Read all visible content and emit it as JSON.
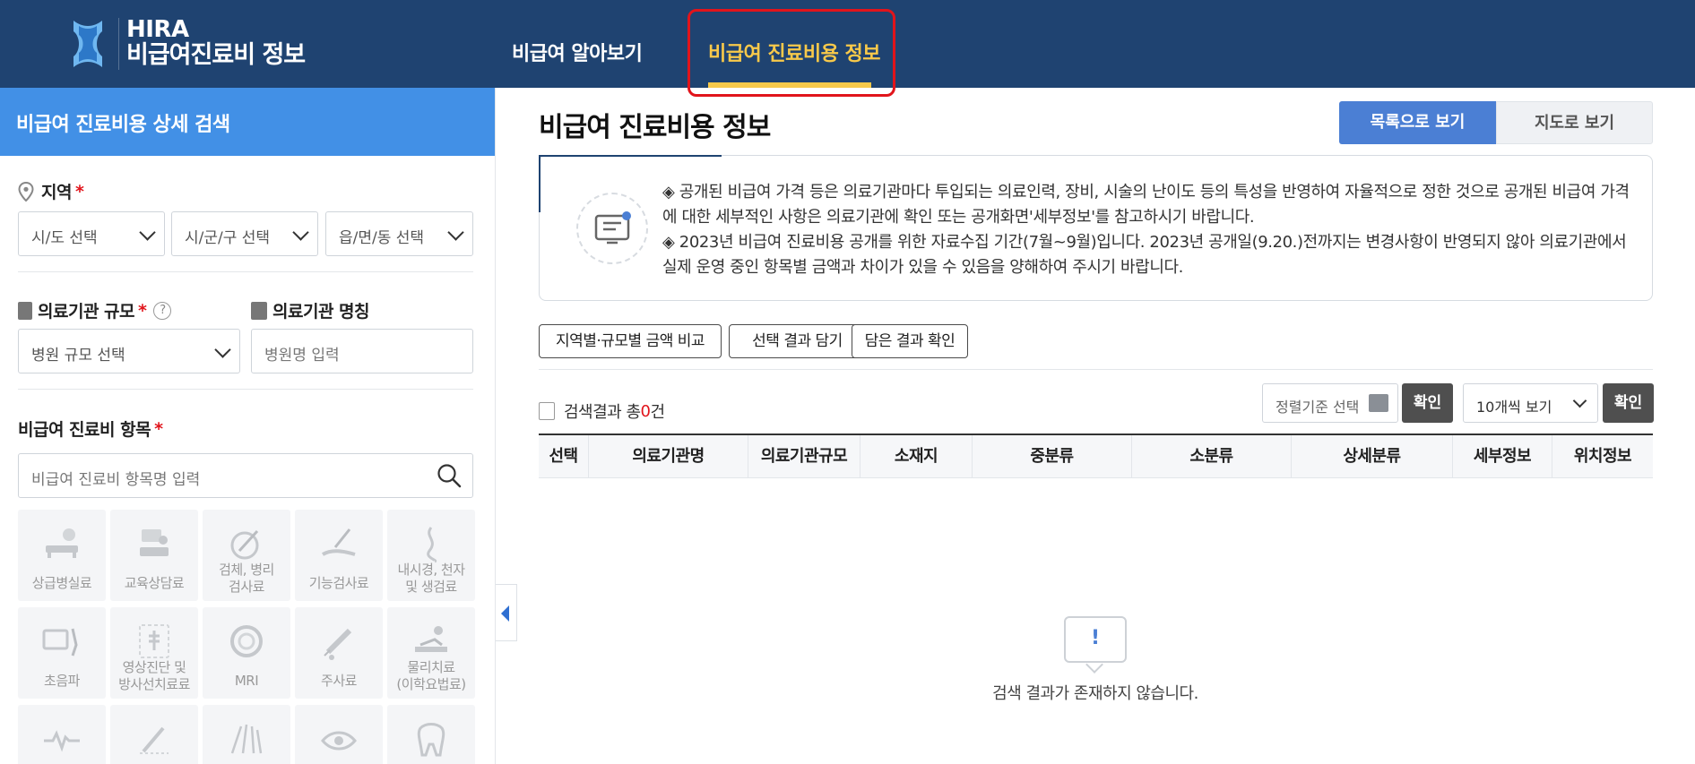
{
  "header": {
    "logo_line1": "HIRA",
    "logo_line2": "비급여진료비 정보",
    "nav": [
      {
        "label": "비급여 알아보기"
      },
      {
        "label": "비급여 진료비용 정보"
      }
    ],
    "active_color": "#f8c94a",
    "bg_color": "#1f4371"
  },
  "sidebar": {
    "title": "비급여 진료비용 상세 검색",
    "region": {
      "label": "지역",
      "required": "*",
      "sido": "시/도 선택",
      "sigungu": "시/군/구 선택",
      "emd": "읍/면/동 선택"
    },
    "scale": {
      "label": "의료기관 규모",
      "required": "*",
      "help": "?",
      "value": "병원 규모 선택"
    },
    "name": {
      "label": "의료기관 명칭",
      "placeholder": "병원명 입력"
    },
    "item": {
      "label": "비급여 진료비 항목",
      "required": "*",
      "placeholder": "비급여 진료비 항목명 입력"
    },
    "tiles": [
      {
        "label": "상급병실료",
        "icon": "bed-icon"
      },
      {
        "label": "교육상담료",
        "icon": "counseling-icon"
      },
      {
        "label": "검체, 병리\n검사료",
        "icon": "specimen-icon"
      },
      {
        "label": "기능검사료",
        "icon": "function-test-icon"
      },
      {
        "label": "내시경, 천자\n및 생검료",
        "icon": "endoscope-icon"
      },
      {
        "label": "초음파",
        "icon": "ultrasound-icon"
      },
      {
        "label": "영상진단 및\n방사선치료료",
        "icon": "xray-icon"
      },
      {
        "label": "MRI",
        "icon": "mri-icon"
      },
      {
        "label": "주사료",
        "icon": "syringe-icon"
      },
      {
        "label": "물리치료\n(이학요법료)",
        "icon": "physiotherapy-icon"
      },
      {
        "label": "",
        "icon": "heartbeat-icon"
      },
      {
        "label": "",
        "icon": "surgery-icon"
      },
      {
        "label": "",
        "icon": "acupuncture-icon"
      },
      {
        "label": "",
        "icon": "eye-icon"
      },
      {
        "label": "",
        "icon": "tooth-icon"
      }
    ]
  },
  "main": {
    "title": "비급여 진료비용 정보",
    "view_list": "목록으로 보기",
    "view_map": "지도로 보기",
    "notice_1": "◈ 공개된 비급여 가격 등은 의료기관마다 투입되는 의료인력, 장비, 시술의 난이도 등의 특성을 반영하여 자율적으로 정한 것으로 공개된 비급여 가격에 대한 세부적인 사항은 의료기관에 확인 또는 공개화면'세부정보'를 참고하시기 바랍니다.",
    "notice_2": "◈ 2023년 비급여 진료비용 공개를 위한 자료수집 기간(7월~9월)입니다. 2023년 공개일(9.20.)전까지는 변경사항이 반영되지 않아 의료기관에서 실제 운영 중인 항목별 금액과 차이가 있을 수 있음을 양해하여 주시기 바랍니다.",
    "btn_compare": "지역별·규모별 금액 비교",
    "btn_save": "선택 결과 담기",
    "btn_check": "담은 결과 확인",
    "result_prefix": "검색결과 총",
    "result_count": "0",
    "result_suffix": "건",
    "sort_label": "정렬기준 선택",
    "confirm": "확인",
    "per_page": "10개씩 보기",
    "columns": [
      "선택",
      "의료기관명",
      "의료기관규모",
      "소재지",
      "중분류",
      "소분류",
      "상세분류",
      "세부정보",
      "위치정보"
    ],
    "empty_mark": "!",
    "empty_text": "검색 결과가 존재하지 않습니다."
  }
}
